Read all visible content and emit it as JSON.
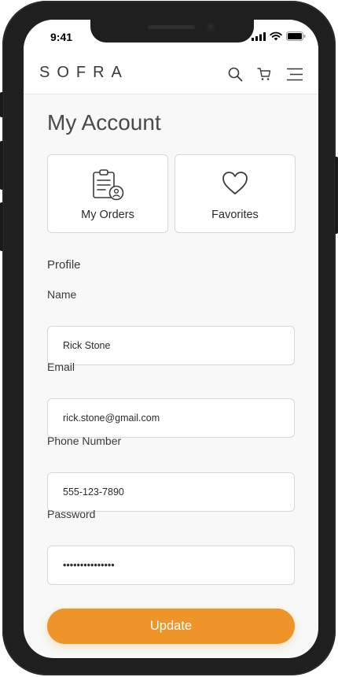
{
  "status_bar": {
    "time": "9:41"
  },
  "app": {
    "logo": "SOFRA",
    "icons": [
      "search-icon",
      "cart-icon",
      "menu-icon"
    ]
  },
  "page": {
    "title": "My Account"
  },
  "tiles": [
    {
      "label": "My Orders",
      "icon": "orders-icon"
    },
    {
      "label": "Favorites",
      "icon": "heart-icon"
    }
  ],
  "profile": {
    "section_title": "Profile",
    "fields": {
      "name": {
        "label": "Name",
        "value": "Rick Stone"
      },
      "email": {
        "label": "Email",
        "value": "rick.stone@gmail.com"
      },
      "phone": {
        "label": "Phone Number",
        "value": "555-123-7890"
      },
      "password": {
        "label": "Password",
        "value": "•••••••••••••••"
      }
    },
    "update_label": "Update"
  },
  "colors": {
    "accent": "#ee9428",
    "background": "#f7f8f7",
    "phone_frame": "#1f1f1f"
  }
}
